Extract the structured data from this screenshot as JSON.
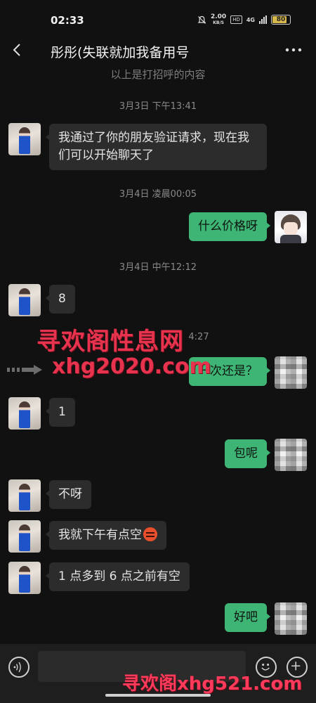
{
  "status_bar": {
    "time": "02:33",
    "net_speed_value": "2.00",
    "net_speed_unit": "KB/S",
    "hd_badge": "HD",
    "network": "4G",
    "battery_level": "80"
  },
  "header": {
    "title": "彤彤(失联就加我备用号",
    "back_icon": "chevron-left-icon",
    "more_icon": "more-dots-icon"
  },
  "intro_text": "以上是打招呼的内容",
  "messages": [
    {
      "kind": "time",
      "text": "3月3日 下午13:41"
    },
    {
      "kind": "msg",
      "side": "in",
      "text": "我通过了你的朋友验证请求，现在我们可以开始聊天了"
    },
    {
      "kind": "time",
      "text": "3月4日 凌晨00:05"
    },
    {
      "kind": "msg",
      "side": "out",
      "text": "什么价格呀"
    },
    {
      "kind": "time",
      "text": "3月4日 中午12:12"
    },
    {
      "kind": "msg",
      "side": "in",
      "text": "8"
    },
    {
      "kind": "time_partial",
      "text": "4:27"
    },
    {
      "kind": "msg",
      "side": "out",
      "text": "一次还是？"
    },
    {
      "kind": "msg",
      "side": "in",
      "text": "1"
    },
    {
      "kind": "msg",
      "side": "out",
      "text": "包呢"
    },
    {
      "kind": "msg",
      "side": "in",
      "text": "不呀"
    },
    {
      "kind": "msg",
      "side": "in",
      "text": "我就下午有点空"
    },
    {
      "kind": "msg",
      "side": "in",
      "text": "1 点多到 6 点之前有空"
    },
    {
      "kind": "msg",
      "side": "out",
      "text": "好吧"
    }
  ],
  "watermarks": {
    "site_name": "寻欢阁性息网",
    "site_url": "xhg2020.com",
    "bottom": "寻欢阁xhg521.com"
  },
  "input_bar": {
    "voice_icon": "voice-icon",
    "emoji_icon": "smile-icon",
    "plus_icon": "plus-icon"
  },
  "colors": {
    "background": "#111111",
    "incoming_bubble": "#2c2c2c",
    "outgoing_bubble": "#3eb575",
    "watermark": "#e8334f"
  }
}
